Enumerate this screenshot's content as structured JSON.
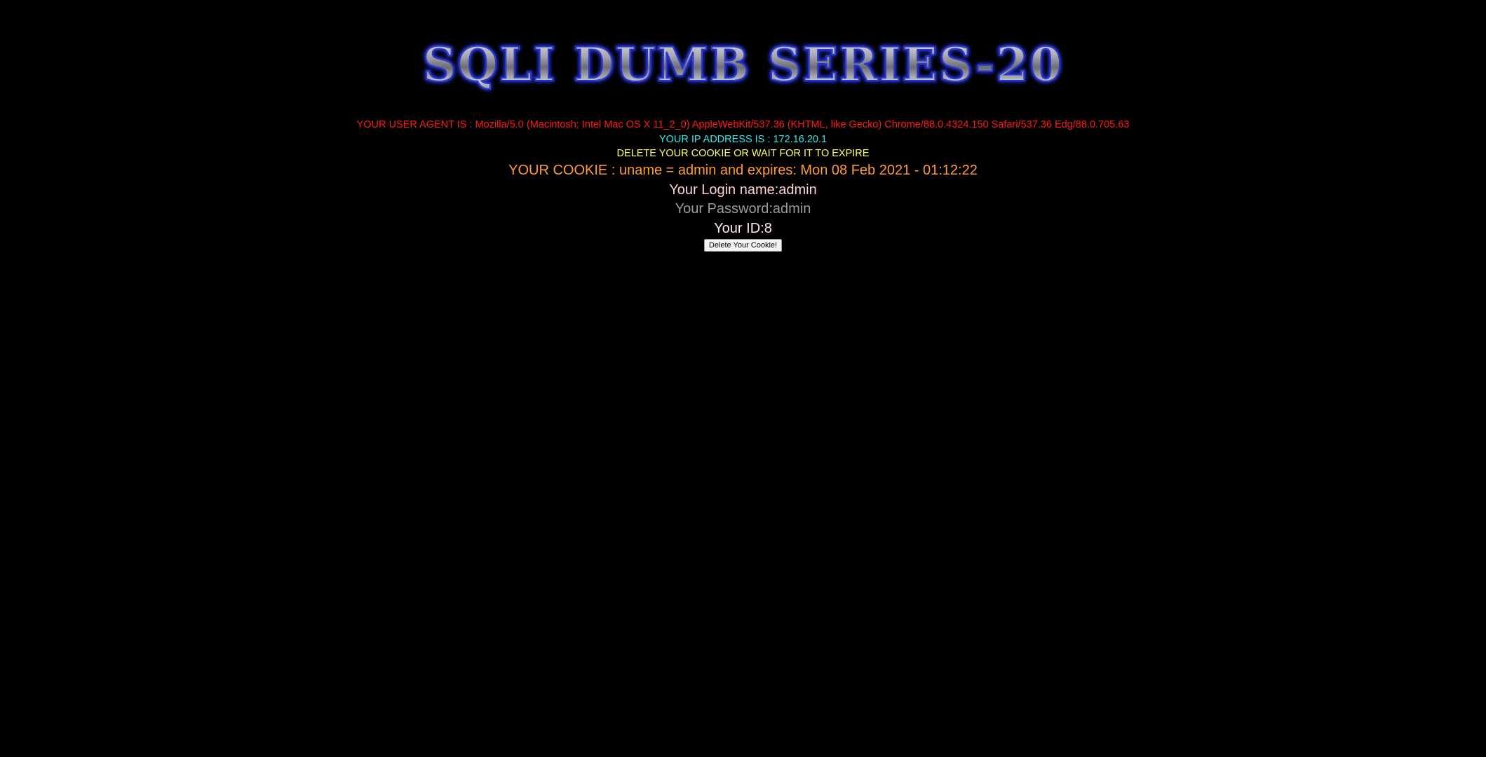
{
  "header": {
    "title": "SQLI DUMB SERIES-20"
  },
  "info": {
    "user_agent": "YOUR USER AGENT IS : Mozilla/5.0 (Macintosh; Intel Mac OS X 11_2_0) AppleWebKit/537.36 (KHTML, like Gecko) Chrome/88.0.4324.150 Safari/537.36 Edg/88.0.705.63",
    "ip_address": "YOUR IP ADDRESS IS : 172.16.20.1",
    "delete_notice": "DELETE YOUR COOKIE OR WAIT FOR IT TO EXPIRE",
    "cookie": "YOUR COOKIE : uname = admin and expires: Mon 08 Feb 2021 - 01:12:22",
    "login_name": "Your Login name:admin",
    "password": "Your Password:admin",
    "id": "Your ID:8"
  },
  "actions": {
    "delete_cookie_label": "Delete Your Cookie!"
  },
  "colors": {
    "background": "#000000",
    "user_agent": "#ff1a1a",
    "ip_address": "#33e8e8",
    "delete_notice": "#ffff66",
    "cookie": "#ff9c33",
    "title_outline": "#2a35c9"
  }
}
